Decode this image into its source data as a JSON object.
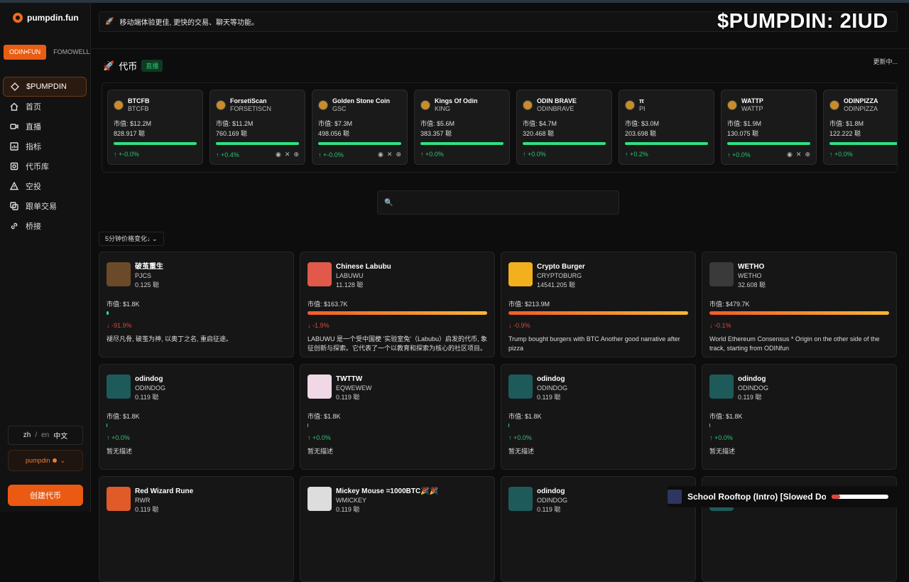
{
  "app": {
    "name": "pumpdin.fun"
  },
  "sidebar": {
    "platform_tabs": [
      "ODIN•FUN",
      "FOMOWELL"
    ],
    "items": [
      {
        "label": "$PUMPDIN",
        "icon": "diamond-icon"
      },
      {
        "label": "首页",
        "icon": "home-icon"
      },
      {
        "label": "直播",
        "icon": "video-icon"
      },
      {
        "label": "指标",
        "icon": "chart-icon"
      },
      {
        "label": "代币库",
        "icon": "library-icon"
      },
      {
        "label": "空投",
        "icon": "airdrop-icon"
      },
      {
        "label": "跟单交易",
        "icon": "copy-icon"
      },
      {
        "label": "桥接",
        "icon": "link-icon"
      }
    ],
    "lang": {
      "zh": "zh",
      "sep": "/",
      "en": "en",
      "current": "中文"
    },
    "user": "pumpdin",
    "create_label": "创建代币"
  },
  "banner": {
    "text": "移动端体验更佳, 更快的交易、聊天等功能。"
  },
  "overlay": {
    "ticker": "$PUMPDIN: 2IUD"
  },
  "tokens_section": {
    "title": "代币",
    "badge": "直播",
    "status": "更新中..."
  },
  "token_strip": [
    {
      "name": "BTCFB",
      "symbol": "BTCFB",
      "mcap": "市值: $12.2M",
      "amount": "828.917 聪",
      "change": "↑ +-0.0%",
      "socials": false
    },
    {
      "name": "ForsetiScan",
      "symbol": "FORSETISCN",
      "mcap": "市值: $11.2M",
      "amount": "760.169 聪",
      "change": "↑ +0.4%",
      "socials": true
    },
    {
      "name": "Golden Stone Coin",
      "symbol": "GSC",
      "mcap": "市值: $7.3M",
      "amount": "498.056 聪",
      "change": "↑ +-0.0%",
      "socials": true
    },
    {
      "name": "Kings Of Odin",
      "symbol": "KING",
      "mcap": "市值: $5.6M",
      "amount": "383.357 聪",
      "change": "↑ +0.0%",
      "socials": false
    },
    {
      "name": "ODIN BRAVE",
      "symbol": "ODINBRAVE",
      "mcap": "市值: $4.7M",
      "amount": "320.468 聪",
      "change": "↑ +0.0%",
      "socials": false
    },
    {
      "name": "π",
      "symbol": "PI",
      "mcap": "市值: $3.0M",
      "amount": "203.698 聪",
      "change": "↑ +0.2%",
      "socials": false
    },
    {
      "name": "WATTP",
      "symbol": "WATTP",
      "mcap": "市值: $1.9M",
      "amount": "130.075 聪",
      "change": "↑ +0.0%",
      "socials": true
    },
    {
      "name": "ODINPIZZA",
      "symbol": "ODINPIZZA",
      "mcap": "市值: $1.8M",
      "amount": "122.222 聪",
      "change": "↑ +0.0%",
      "socials": false
    }
  ],
  "search": {
    "placeholder": ""
  },
  "sort": {
    "label": "5分钟价格变化↓"
  },
  "cards": [
    {
      "name": "破茧重生",
      "symbol": "PJCS",
      "value": "0.125 聪",
      "mcap": "市值: $1.8K",
      "change": "↓ -91.9%",
      "dir": "down",
      "bar": "green-short",
      "desc": "褪尽凡骨, 破茧为神, 以奥丁之名, 重启征途。",
      "color": "#6b4a2a"
    },
    {
      "name": "Chinese Labubu",
      "symbol": "LABUWU",
      "value": "11.128 聪",
      "mcap": "市值: $163.7K",
      "change": "↓ -1.9%",
      "dir": "down",
      "bar": "orange",
      "desc": "LABUWU 是一个受中国梗 '实验室兔'（Labubu）启发的代币, 象征创新与探索。它代表了一个以教育和探索为核心的社区项目。该代币受到...",
      "color": "#e0594a"
    },
    {
      "name": "Crypto Burger",
      "symbol": "CRYPTOBURG",
      "value": "14541.205 聪",
      "mcap": "市值: $213.9M",
      "change": "↓ -0.9%",
      "dir": "down",
      "bar": "orange",
      "desc": "Trump bought burgers with BTC Another good narrative after pizza",
      "color": "#f2b01e"
    },
    {
      "name": "WETHO",
      "symbol": "WETHO",
      "value": "32.608 聪",
      "mcap": "市值: $479.7K",
      "change": "↓ -0.1%",
      "dir": "down",
      "bar": "orange",
      "desc": "World Ethereum Consensus * Origin on the other side of the track, starting from ODINfun",
      "color": "#3a3a3a"
    },
    {
      "name": "odindog",
      "symbol": "ODINDOG",
      "value": "0.119 聪",
      "mcap": "市值: $1.8K",
      "change": "↑ +0.0%",
      "dir": "up",
      "bar": "none",
      "desc": "暂无描述",
      "color": "#1f5a5a"
    },
    {
      "name": "TWTTW",
      "symbol": "EQWEWEW",
      "value": "0.119 聪",
      "mcap": "市值: $1.8K",
      "change": "↑ +0.0%",
      "dir": "up",
      "bar": "none",
      "desc": "暂无描述",
      "color": "#f0d8e6"
    },
    {
      "name": "odindog",
      "symbol": "ODINDOG",
      "value": "0.119 聪",
      "mcap": "市值: $1.8K",
      "change": "↑ +0.0%",
      "dir": "up",
      "bar": "none",
      "desc": "暂无描述",
      "color": "#1f5a5a"
    },
    {
      "name": "odindog",
      "symbol": "ODINDOG",
      "value": "0.119 聪",
      "mcap": "市值: $1.8K",
      "change": "↑ +0.0%",
      "dir": "up",
      "bar": "none",
      "desc": "暂无描述",
      "color": "#1f5a5a"
    },
    {
      "name": "Red Wizard Rune",
      "symbol": "RWR",
      "value": "0.119 聪",
      "mcap": "",
      "change": "",
      "dir": "up",
      "bar": "none",
      "desc": "",
      "color": "#e05a2a"
    },
    {
      "name": "Mickey Mouse =1000BTC🎉🎉",
      "symbol": "WMICKEY",
      "value": "0.119 聪",
      "mcap": "",
      "change": "",
      "dir": "up",
      "bar": "none",
      "desc": "",
      "color": "#dddddd"
    },
    {
      "name": "odindog",
      "symbol": "ODINDOG",
      "value": "0.119 聪",
      "mcap": "",
      "change": "",
      "dir": "up",
      "bar": "none",
      "desc": "",
      "color": "#1f5a5a"
    },
    {
      "name": "odindog",
      "symbol": "ODINDOG",
      "value": "",
      "mcap": "",
      "change": "",
      "dir": "up",
      "bar": "none",
      "desc": "",
      "color": "#1f5a5a"
    }
  ],
  "player": {
    "title": "School Rooftop (Intro) [Slowed Down]",
    "progress": 0.15
  }
}
